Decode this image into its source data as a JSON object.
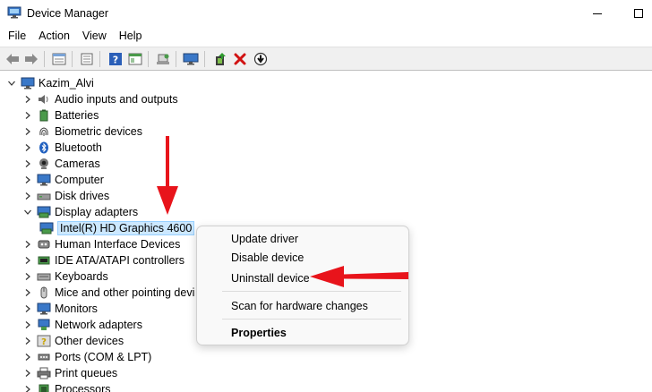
{
  "window": {
    "title": "Device Manager",
    "icon": "device-manager-icon"
  },
  "menu": {
    "items": [
      "File",
      "Action",
      "View",
      "Help"
    ]
  },
  "toolbar": {
    "icons": [
      "back-icon",
      "forward-icon",
      "properties-icon",
      "show-hidden-icon",
      "help-icon",
      "view-icon",
      "scan-icon",
      "monitor-icon",
      "update-driver-icon",
      "uninstall-icon",
      "disable-icon"
    ],
    "colors": {
      "uninstall": "#d11111",
      "help": "#2b5fb8"
    }
  },
  "tree": {
    "root": "Kazim_Alvi",
    "categories": [
      {
        "label": "Audio inputs and outputs",
        "icon": "speaker-icon"
      },
      {
        "label": "Batteries",
        "icon": "battery-icon"
      },
      {
        "label": "Biometric devices",
        "icon": "fingerprint-icon"
      },
      {
        "label": "Bluetooth",
        "icon": "bluetooth-icon"
      },
      {
        "label": "Cameras",
        "icon": "camera-icon"
      },
      {
        "label": "Computer",
        "icon": "computer-icon"
      },
      {
        "label": "Disk drives",
        "icon": "disk-icon"
      },
      {
        "label": "Display adapters",
        "icon": "display-adapter-icon",
        "expanded": true
      },
      {
        "label": "Intel(R) HD Graphics 4600",
        "icon": "display-adapter-icon",
        "child": true,
        "selected": true
      },
      {
        "label": "Human Interface Devices",
        "icon": "hid-icon"
      },
      {
        "label": "IDE ATA/ATAPI controllers",
        "icon": "ide-icon"
      },
      {
        "label": "Keyboards",
        "icon": "keyboard-icon"
      },
      {
        "label": "Mice and other pointing devi",
        "icon": "mouse-icon"
      },
      {
        "label": "Monitors",
        "icon": "monitor-icon"
      },
      {
        "label": "Network adapters",
        "icon": "network-icon"
      },
      {
        "label": "Other devices",
        "icon": "question-icon"
      },
      {
        "label": "Ports (COM & LPT)",
        "icon": "port-icon"
      },
      {
        "label": "Print queues",
        "icon": "printer-icon"
      },
      {
        "label": "Processors",
        "icon": "processor-icon"
      }
    ]
  },
  "context_menu": {
    "items": [
      {
        "label": "Update driver"
      },
      {
        "label": "Disable device"
      },
      {
        "label": "Uninstall device"
      },
      {
        "label": "Scan for hardware changes"
      },
      {
        "label": "Properties",
        "bold": true
      }
    ]
  },
  "annotations": {
    "arrow_color": "#e8141b"
  }
}
